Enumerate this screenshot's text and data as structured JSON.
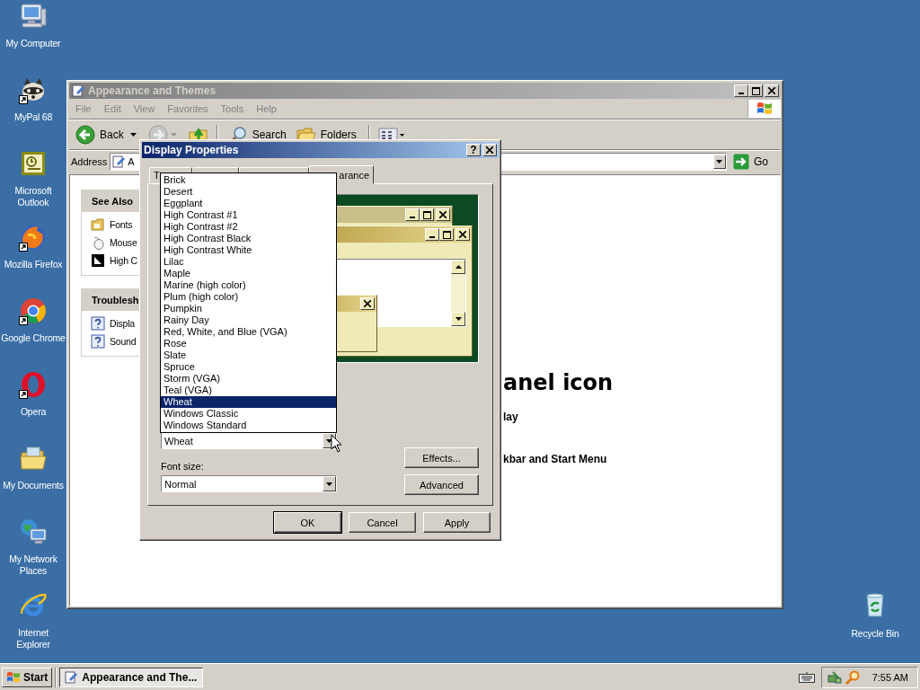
{
  "desktop": {
    "icons": [
      {
        "label": "My Computer",
        "shortcut": false
      },
      {
        "label": "MyPal 68",
        "shortcut": true
      },
      {
        "label": "Microsoft Outlook",
        "shortcut": false
      },
      {
        "label": "Mozilla Firefox",
        "shortcut": true
      },
      {
        "label": "Google Chrome",
        "shortcut": true
      },
      {
        "label": "Opera",
        "shortcut": true
      },
      {
        "label": "My Documents",
        "shortcut": false
      },
      {
        "label": "My Network Places",
        "shortcut": false
      },
      {
        "label": "Internet Explorer",
        "shortcut": false
      }
    ],
    "recycle_bin": {
      "label": "Recycle Bin"
    }
  },
  "explorer": {
    "title": "Appearance and Themes",
    "active": false,
    "menu": [
      "File",
      "Edit",
      "View",
      "Favorites",
      "Tools",
      "Help"
    ],
    "toolbar": {
      "back": "Back",
      "search": "Search",
      "folders": "Folders"
    },
    "address": {
      "label": "Address",
      "value": "A",
      "go": "Go"
    },
    "see_also": {
      "title": "See Also",
      "items": [
        "Fonts",
        "Mouse",
        "High C"
      ]
    },
    "troubleshooters": {
      "title": "Troublesh",
      "items": [
        "Displa",
        "Sound"
      ]
    },
    "content": {
      "heading": "anel icon",
      "links": [
        "lay",
        "kbar and Start Menu"
      ]
    }
  },
  "dialog": {
    "title": "Display Properties",
    "help": "?",
    "tabs": [
      {
        "label": "T",
        "selected": false
      },
      {
        "selected": false
      },
      {
        "selected": false
      },
      {
        "label": "arance",
        "selected": true
      }
    ],
    "color_scheme": {
      "value": "Wheat",
      "open": true
    },
    "scheme_list": [
      {
        "label": "Brick",
        "selected": false
      },
      {
        "label": "Desert",
        "selected": false
      },
      {
        "label": "Eggplant",
        "selected": false
      },
      {
        "label": "High Contrast #1",
        "selected": false
      },
      {
        "label": "High Contrast #2",
        "selected": false
      },
      {
        "label": "High Contrast Black",
        "selected": false
      },
      {
        "label": "High Contrast White",
        "selected": false
      },
      {
        "label": "Lilac",
        "selected": false
      },
      {
        "label": "Maple",
        "selected": false
      },
      {
        "label": "Marine (high color)",
        "selected": false
      },
      {
        "label": "Plum (high color)",
        "selected": false
      },
      {
        "label": "Pumpkin",
        "selected": false
      },
      {
        "label": "Rainy Day",
        "selected": false
      },
      {
        "label": "Red, White, and Blue (VGA)",
        "selected": false
      },
      {
        "label": "Rose",
        "selected": false
      },
      {
        "label": "Slate",
        "selected": false
      },
      {
        "label": "Spruce",
        "selected": false
      },
      {
        "label": "Storm (VGA)",
        "selected": false
      },
      {
        "label": "Teal (VGA)",
        "selected": false
      },
      {
        "label": "Wheat",
        "selected": true
      },
      {
        "label": "Windows Classic",
        "selected": false
      },
      {
        "label": "Windows Standard",
        "selected": false
      }
    ],
    "font_size": {
      "label": "Font size:",
      "value": "Normal"
    },
    "buttons": {
      "effects": "Effects...",
      "advanced": "Advanced",
      "ok": "OK",
      "cancel": "Cancel",
      "apply": "Apply"
    }
  },
  "taskbar": {
    "start": "Start",
    "tasks": [
      {
        "label": "Appearance and The...",
        "selected": true
      }
    ],
    "clock": "7:55 AM"
  }
}
